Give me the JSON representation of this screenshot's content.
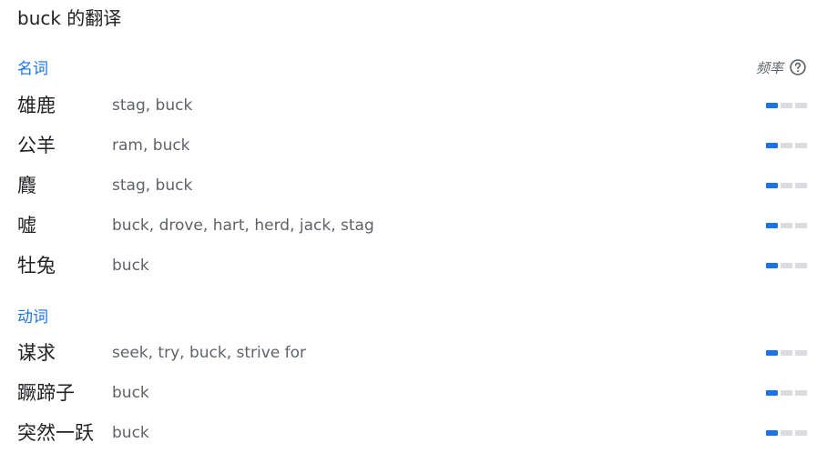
{
  "title": "buck 的翻译",
  "frequency_label": "频率",
  "colors": {
    "accent": "#1a73e8",
    "bar_off": "#dadce0"
  },
  "sections": [
    {
      "pos": "名词",
      "rows": [
        {
          "term": "雄鹿",
          "synonyms": "stag, buck",
          "frequency": 1
        },
        {
          "term": "公羊",
          "synonyms": "ram, buck",
          "frequency": 1
        },
        {
          "term": "麚",
          "synonyms": "stag, buck",
          "frequency": 1
        },
        {
          "term": "嘘",
          "synonyms": "buck, drove, hart, herd, jack, stag",
          "frequency": 1
        },
        {
          "term": "牡兔",
          "synonyms": "buck",
          "frequency": 1
        }
      ]
    },
    {
      "pos": "动词",
      "rows": [
        {
          "term": "谋求",
          "synonyms": "seek, try, buck, strive for",
          "frequency": 1
        },
        {
          "term": "蹶蹄子",
          "synonyms": "buck",
          "frequency": 1
        },
        {
          "term": "突然一跃",
          "synonyms": "buck",
          "frequency": 1
        }
      ]
    }
  ]
}
